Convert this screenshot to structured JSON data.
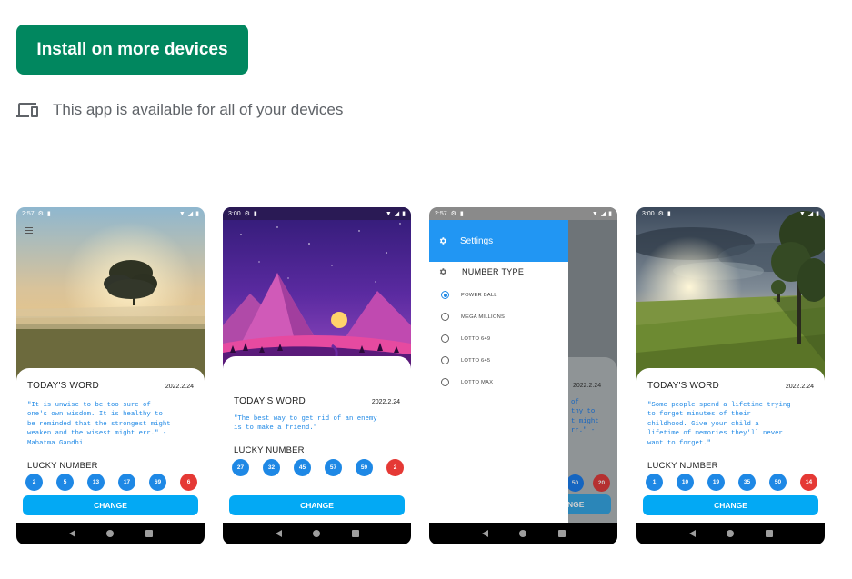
{
  "install_button": {
    "label": "Install on more devices"
  },
  "availability": {
    "icon": "devices-icon",
    "text": "This app is available for all of your devices"
  },
  "screenshots": [
    {
      "time": "2:57",
      "title": "TODAY'S WORD",
      "date": "2022.2.24",
      "quote": "\"It is unwise to be too sure of\none's own wisdom. It is healthy to\nbe reminded that the strongest might\nweaken and the wisest might err.\" -\nMahatma Gandhi",
      "lucky_label": "LUCKY NUMBER",
      "numbers": [
        "2",
        "5",
        "13",
        "17",
        "69",
        "6"
      ],
      "change_label": "CHANGE"
    },
    {
      "time": "3:00",
      "title": "TODAY'S WORD",
      "date": "2022.2.24",
      "quote": "\"The best way to get rid of an enemy\nis to make a friend.\"",
      "lucky_label": "LUCKY NUMBER",
      "numbers": [
        "27",
        "32",
        "45",
        "57",
        "59",
        "2"
      ],
      "change_label": "CHANGE"
    },
    {
      "time": "2:57",
      "drawer_title": "Settings",
      "section_label": "NUMBER TYPE",
      "options": [
        "POWER BALL",
        "MEGA MILLIONS",
        "LOTTO 649",
        "LOTTO 645",
        "LOTTO MAX"
      ],
      "selected_option": "POWER BALL",
      "peek_date": "2022.2.24",
      "peek_quote": "of\nthy to\nt might\nrr.\" -",
      "peek_numbers": [
        "50",
        "20"
      ],
      "peek_change": "NGE"
    },
    {
      "time": "3:00",
      "title": "TODAY'S WORD",
      "date": "2022.2.24",
      "quote": "\"Some people spend a lifetime trying\nto forget minutes of their\nchildhood. Give your child a\nlifetime of memories they'll never\nwant to forget.\"",
      "lucky_label": "LUCKY NUMBER",
      "numbers": [
        "1",
        "10",
        "19",
        "35",
        "50",
        "14"
      ],
      "change_label": "CHANGE"
    }
  ],
  "colors": {
    "install_green": "#01875f",
    "ball_blue": "#1e88e5",
    "ball_red": "#e53935",
    "change_blue": "#03a9f4",
    "drawer_blue": "#2196f3"
  }
}
